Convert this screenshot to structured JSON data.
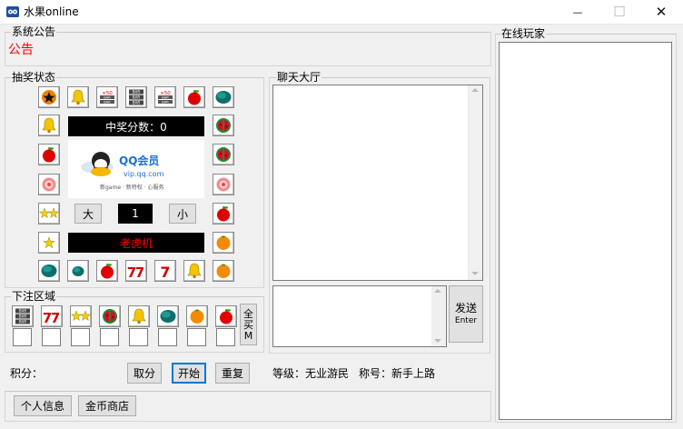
{
  "window": {
    "title": "水果online",
    "minimize_glyph": "—",
    "maximize_glyph": "☐",
    "close_glyph": "✕"
  },
  "announcement": {
    "group_title": "系统公告",
    "text": "公告",
    "text_color": "#ff0000"
  },
  "lottery": {
    "group_title": "抽奖状态",
    "score_label": "中奖分数：0",
    "banner": {
      "logo_text": "QQ会员",
      "domain": "vip.qq.com",
      "tagline": "新game · 新特权 · 心服务"
    },
    "big_button": "大",
    "small_button": "小",
    "guess_value": "1",
    "machine_name": "老虎机",
    "machine_name_color": "#ff0000",
    "ring": {
      "top": [
        "orange-star",
        "bell",
        "bar-x50",
        "bar-triple",
        "bar-x50",
        "apple",
        "watermelon"
      ],
      "right": [
        "watermelon-slice",
        "watermelon-slice",
        "lychee",
        "apple",
        "orange"
      ],
      "bottom": [
        "watermelon",
        "watermelon-small",
        "apple",
        "seven-double",
        "seven-single",
        "bell",
        "orange"
      ],
      "left": [
        "bell",
        "apple",
        "lychee",
        "stars-double",
        "star-single"
      ]
    }
  },
  "betting": {
    "group_title": "下注区域",
    "items": [
      "bar-triple",
      "seven-double",
      "stars-double",
      "watermelon-slice",
      "bell",
      "watermelon",
      "orange",
      "apple"
    ],
    "buy_all_label": "全买M"
  },
  "controls": {
    "points_label": "积分：",
    "cash_out": "取分",
    "start": "开始",
    "repeat": "重复",
    "level": "等级：无业游民",
    "rank": "称号：新手上路"
  },
  "chat": {
    "group_title": "聊天大厅",
    "send_label": "发送",
    "send_hint": "Enter"
  },
  "online": {
    "group_title": "在线玩家"
  },
  "footer": {
    "profile": "个人信息",
    "shop": "金币商店"
  },
  "colors": {
    "window_bg": "#f0f0f0",
    "focus_border": "#0078d7"
  }
}
